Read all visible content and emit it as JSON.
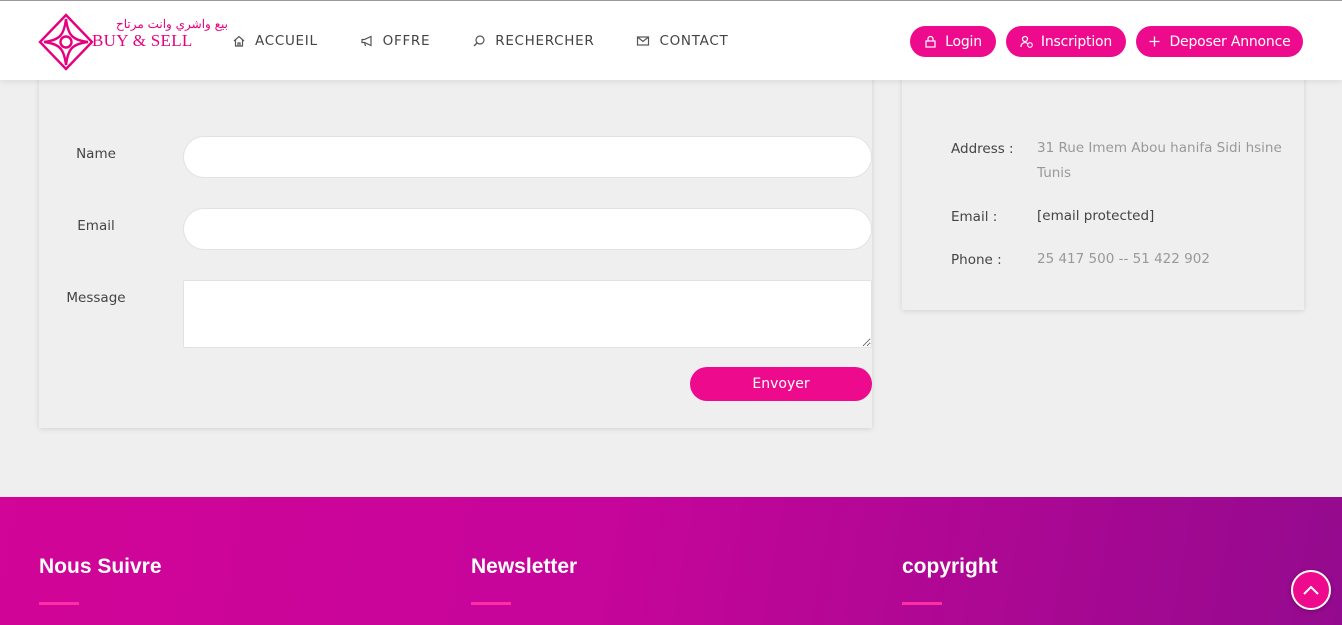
{
  "brand": {
    "arabic": "بيع واشري وانت مرتاح",
    "name": "BUY & SELL",
    "color": "#e6007e"
  },
  "nav": {
    "items": [
      {
        "label": "ACCUEIL",
        "icon": "home-icon"
      },
      {
        "label": "OFFRE",
        "icon": "megaphone-icon"
      },
      {
        "label": "RECHERCHER",
        "icon": "search-icon"
      },
      {
        "label": "CONTACT",
        "icon": "mail-icon"
      }
    ]
  },
  "header_buttons": {
    "login": "Login",
    "signup": "Inscription",
    "post_ad": "Deposer Annonce"
  },
  "form": {
    "name_label": "Name",
    "email_label": "Email",
    "message_label": "Message",
    "submit_label": "Envoyer"
  },
  "contact_info": {
    "address_label": "Address :",
    "address_value": "31 Rue Imem Abou hanifa Sidi hsine Tunis",
    "email_label": "Email :",
    "email_value": "[email protected]",
    "phone_label": "Phone :",
    "phone_value": "25 417 500 -- 51 422 902"
  },
  "footer": {
    "col1": "Nous Suivre",
    "col2": "Newsletter",
    "col3": "copyright"
  },
  "colors": {
    "accent": "#ee0a8d",
    "footer_start": "#d10598",
    "footer_end": "#940a8e"
  }
}
